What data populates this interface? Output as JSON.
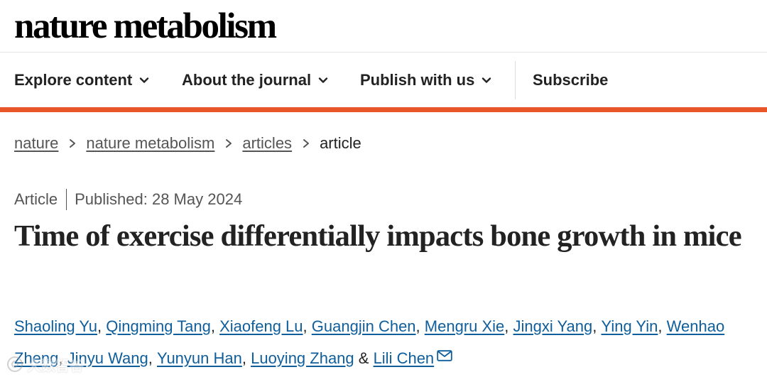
{
  "masthead": {
    "logo_text": "nature metabolism"
  },
  "nav": {
    "explore_label": "Explore content",
    "about_label": "About the journal",
    "publish_label": "Publish with us",
    "subscribe_label": "Subscribe"
  },
  "breadcrumb": [
    "nature",
    "nature metabolism",
    "articles",
    "article"
  ],
  "article": {
    "type": "Article",
    "published": "Published: 28 May 2024",
    "title": "Time of exercise differentially impacts bone growth in mice"
  },
  "authors": [
    {
      "name": "Shaoling Yu",
      "sep": ", "
    },
    {
      "name": "Qingming Tang",
      "sep": ", "
    },
    {
      "name": "Xiaofeng Lu",
      "sep": ", "
    },
    {
      "name": "Guangjin Chen",
      "sep": ", "
    },
    {
      "name": "Mengru Xie",
      "sep": ", "
    },
    {
      "name": "Jingxi Yang",
      "sep": ", "
    },
    {
      "name": "Ying Yin",
      "sep": ", "
    },
    {
      "name": "Wenhao Zheng",
      "sep": ", "
    },
    {
      "name": "Jinyu Wang",
      "sep": ", "
    },
    {
      "name": "Yunyun Han",
      "sep": ", "
    },
    {
      "name": "Luoying Zhang",
      "sep": " & "
    },
    {
      "name": "Lili Chen",
      "sep": ""
    }
  ],
  "watermark": {
    "text": "大数智谷"
  },
  "colors": {
    "accent": "#e8562a",
    "link": "#0f5e9c"
  }
}
